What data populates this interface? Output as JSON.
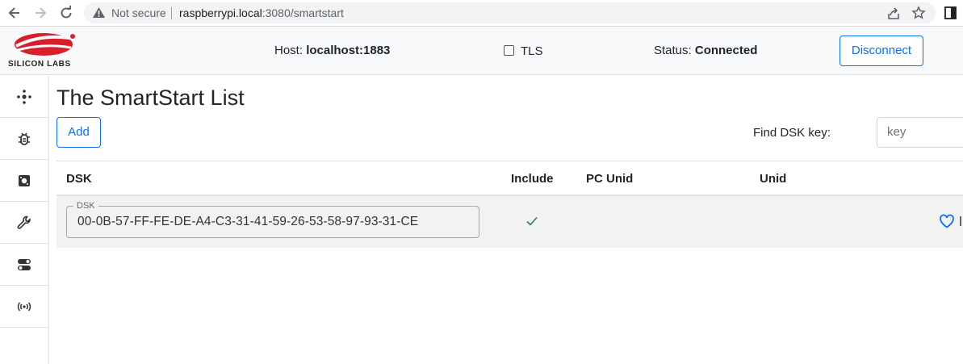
{
  "browser": {
    "security_label": "Not secure",
    "url_host": "raspberrypi.local",
    "url_path": ":3080/smartstart"
  },
  "header": {
    "logo_text": "SILICON LABS",
    "host_label": "Host: ",
    "host_value": "localhost:1883",
    "tls_label": "TLS",
    "status_label": "Status: ",
    "status_value": "Connected",
    "disconnect_label": "Disconnect"
  },
  "sidebar": {
    "items": [
      {
        "icon": "network-icon"
      },
      {
        "icon": "bug-icon"
      },
      {
        "icon": "chip-icon"
      },
      {
        "icon": "wrench-icon"
      },
      {
        "icon": "toggles-icon"
      },
      {
        "icon": "broadcast-icon"
      }
    ]
  },
  "main": {
    "title": "The SmartStart List",
    "add_label": "Add",
    "find_label": "Find DSK key:",
    "find_placeholder": "key",
    "columns": [
      "DSK",
      "Include",
      "PC Unid",
      "Unid"
    ],
    "rows": [
      {
        "dsk_legend": "DSK",
        "dsk": "00-0B-57-FF-FE-DE-A4-C3-31-41-59-26-53-58-97-93-31-CE",
        "include": true
      }
    ]
  },
  "colors": {
    "accent": "#0d6efd",
    "logo_red": "#d91e2a",
    "check_green": "#198754"
  }
}
